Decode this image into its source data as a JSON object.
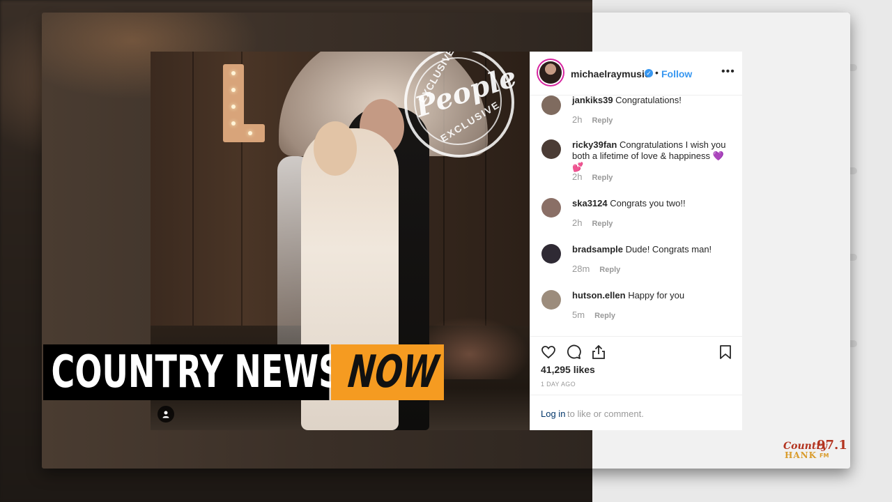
{
  "post": {
    "badge": {
      "word": "People",
      "top_text": "EXCLUSIVE",
      "bottom_text": "EXCLUSIVE"
    },
    "handle": "michaelraymusic",
    "separator": "•",
    "follow_label": "Follow",
    "more_label": "•••",
    "comments": [
      {
        "user": "jankiks39",
        "text": "Congratulations!",
        "time": "2h",
        "reply": "Reply"
      },
      {
        "user": "ricky39fan",
        "text": "Congratulations I wish you both a lifetime of love & happiness 💜💕",
        "time": "2h",
        "reply": "Reply"
      },
      {
        "user": "ska3124",
        "text": "Congrats you two!!",
        "time": "2h",
        "reply": "Reply"
      },
      {
        "user": "bradsample",
        "text": "Dude! Congrats man!",
        "time": "28m",
        "reply": "Reply"
      },
      {
        "user": "hutson.ellen",
        "text": "Happy for you",
        "time": "5m",
        "reply": "Reply"
      }
    ],
    "likes": "41,295 likes",
    "posted": "1 DAY AGO",
    "login_link": "Log in",
    "login_rest": "to like or comment."
  },
  "lower_third": {
    "left": "COUNTRY NEWS",
    "right": "NOW",
    "left_bg": "#000000",
    "right_bg": "#f59b21"
  },
  "station": {
    "word1": "Country",
    "number": "97.1",
    "word2": "HANK",
    "band": "FM"
  },
  "icons": [
    "heart-icon",
    "comment-icon",
    "share-icon",
    "bookmark-icon",
    "verified-icon",
    "user-tag-icon",
    "more-icon"
  ]
}
